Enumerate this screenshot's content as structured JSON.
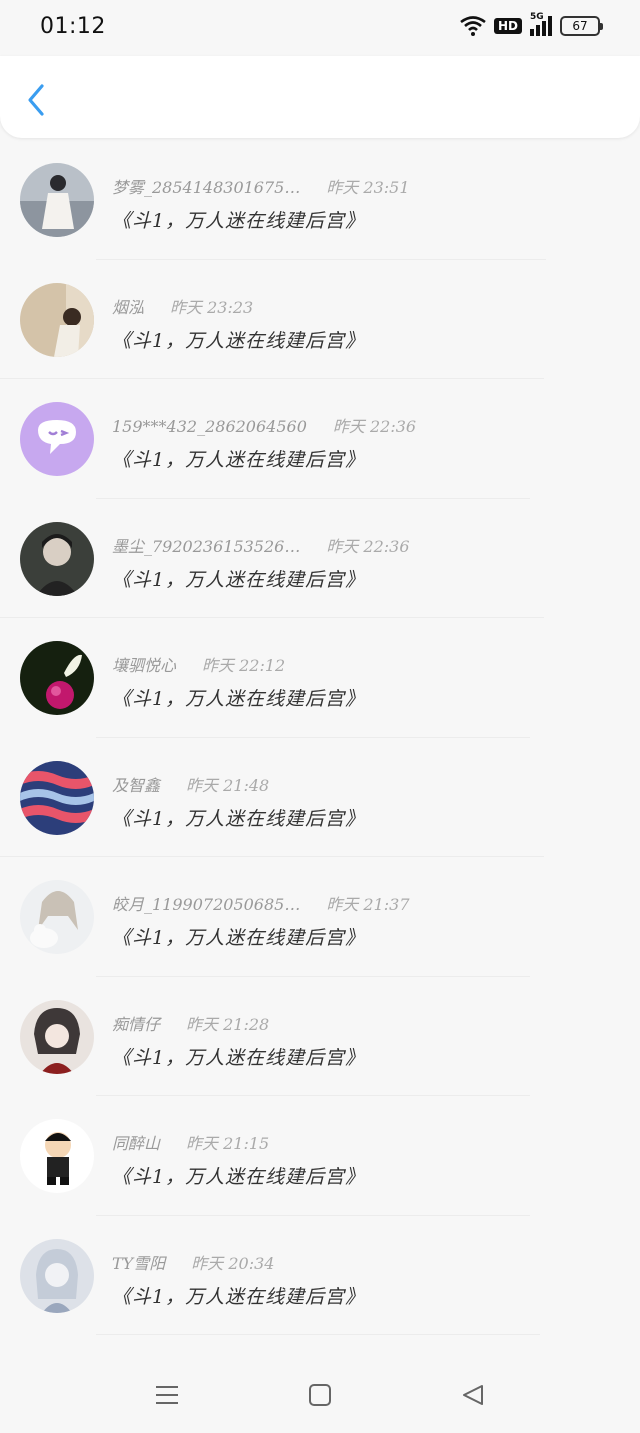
{
  "status": {
    "time": "01:12",
    "hd": "HD",
    "network": "5G",
    "battery": "67"
  },
  "header": {
    "back_icon": "chevron-left-icon",
    "accent": "#3a9df0"
  },
  "items": [
    {
      "name": "梦雾_2854148301675…",
      "time": "昨天 23:51",
      "title": "《斗1，万人迷在线建后宫》"
    },
    {
      "name": "烟泓",
      "time": "昨天 23:23",
      "title": "《斗1，万人迷在线建后宫》"
    },
    {
      "name": "159***432_2862064560",
      "time": "昨天 22:36",
      "title": "《斗1，万人迷在线建后宫》"
    },
    {
      "name": "墨尘_7920236153526…",
      "time": "昨天 22:36",
      "title": "《斗1，万人迷在线建后宫》"
    },
    {
      "name": "壤驷悦心",
      "time": "昨天 22:12",
      "title": "《斗1，万人迷在线建后宫》"
    },
    {
      "name": "及智鑫",
      "time": "昨天 21:48",
      "title": "《斗1，万人迷在线建后宫》"
    },
    {
      "name": "皎月_1199072050685…",
      "time": "昨天 21:37",
      "title": "《斗1，万人迷在线建后宫》"
    },
    {
      "name": "痴情仔",
      "time": "昨天 21:28",
      "title": "《斗1，万人迷在线建后宫》"
    },
    {
      "name": "同醉山",
      "time": "昨天 21:15",
      "title": "《斗1，万人迷在线建后宫》"
    },
    {
      "name": "TY雪阳",
      "time": "昨天 20:34",
      "title": "《斗1，万人迷在线建后宫》"
    }
  ],
  "navbar": {
    "menu_icon": "menu-icon",
    "home_icon": "home-square-icon",
    "back_icon": "back-triangle-icon"
  }
}
